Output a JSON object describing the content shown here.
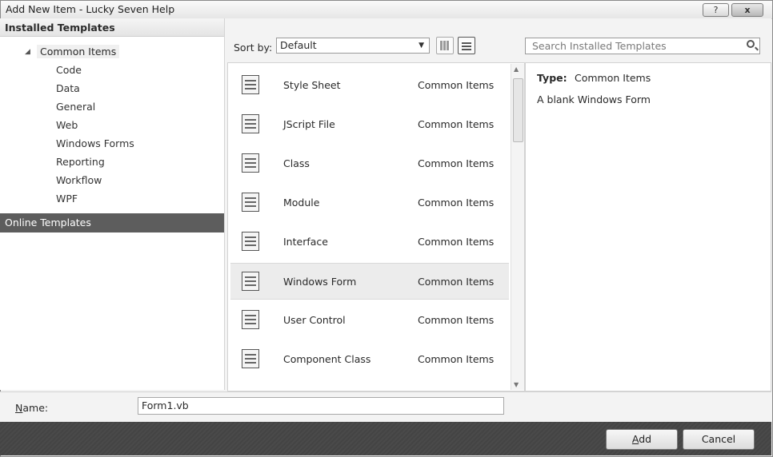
{
  "window": {
    "title": "Add New Item - Lucky Seven Help",
    "help_button": "?",
    "close_button": "x"
  },
  "left": {
    "header": "Installed Templates",
    "root": "Common Items",
    "children": [
      "Code",
      "Data",
      "General",
      "Web",
      "Windows Forms",
      "Reporting",
      "Workflow",
      "WPF"
    ],
    "online": "Online Templates"
  },
  "toolbar": {
    "sort_label": "Sort by:",
    "sort_value": "Default",
    "search_placeholder": "Search Installed Templates"
  },
  "templates": [
    {
      "name": "Style Sheet",
      "category": "Common Items",
      "icon": "style-sheet-icon"
    },
    {
      "name": "JScript File",
      "category": "Common Items",
      "icon": "jscript-file-icon"
    },
    {
      "name": "Class",
      "category": "Common Items",
      "icon": "class-icon"
    },
    {
      "name": "Module",
      "category": "Common Items",
      "icon": "module-icon"
    },
    {
      "name": "Interface",
      "category": "Common Items",
      "icon": "interface-icon"
    },
    {
      "name": "Windows Form",
      "category": "Common Items",
      "icon": "windows-form-icon",
      "selected": true
    },
    {
      "name": "User Control",
      "category": "Common Items",
      "icon": "user-control-icon"
    },
    {
      "name": "Component Class",
      "category": "Common Items",
      "icon": "component-class-icon"
    }
  ],
  "info": {
    "type_label": "Type:",
    "type_value": "Common Items",
    "description": "A blank Windows Form"
  },
  "bottom": {
    "name_label_prefix": "N",
    "name_label_rest": "ame:",
    "name_value": "Form1.vb",
    "add_prefix": "A",
    "add_rest": "dd",
    "cancel": "Cancel"
  }
}
